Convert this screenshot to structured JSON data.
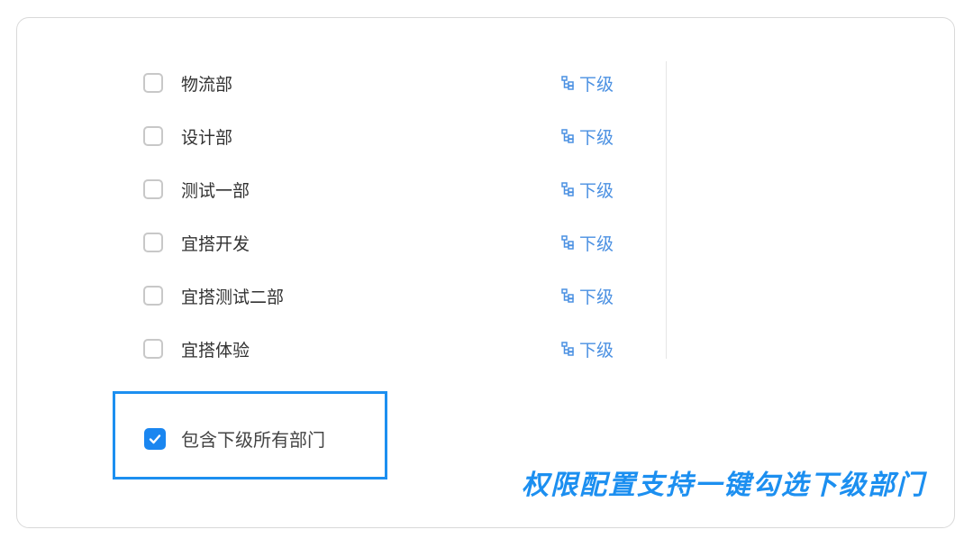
{
  "departments": [
    {
      "label": "物流部",
      "sub_label": "下级"
    },
    {
      "label": "设计部",
      "sub_label": "下级"
    },
    {
      "label": "测试一部",
      "sub_label": "下级"
    },
    {
      "label": "宜搭开发",
      "sub_label": "下级"
    },
    {
      "label": "宜搭测试二部",
      "sub_label": "下级"
    },
    {
      "label": "宜搭体验",
      "sub_label": "下级"
    }
  ],
  "include_sub": {
    "label": "包含下级所有部门",
    "checked": true
  },
  "caption": "权限配置支持一键勾选下级部门",
  "colors": {
    "accent": "#1c8ff0",
    "link": "#4a90e2",
    "checkbox_border": "#c8c8c8",
    "text": "#333333"
  },
  "icons": {
    "sub_link": "org-tree-icon",
    "checked": "checkmark-icon"
  }
}
